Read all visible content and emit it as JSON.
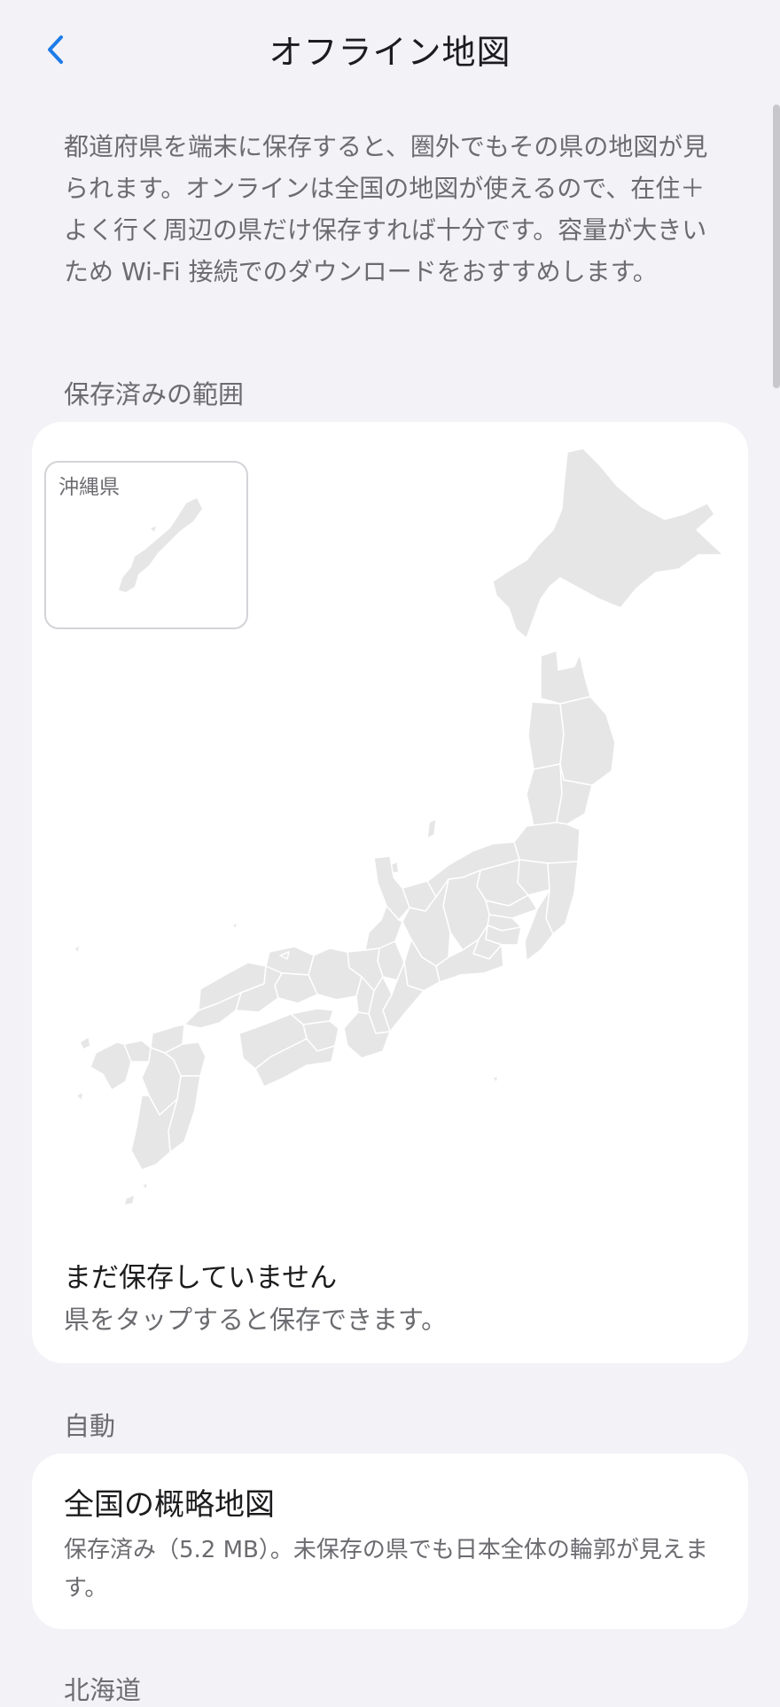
{
  "nav": {
    "title": "オフライン地図",
    "back_icon": "chevron-left-icon",
    "accent_color": "#1e7ce8"
  },
  "intro": "都道府県を端末に保存すると、圏外でもその県の地図が見られます。オンラインは全国の地図が使えるので、在住＋よく行く周辺の県だけ保存すれば十分です。容量が大きいため Wi-Fi 接続でのダウンロードをおすすめします。",
  "saved_section": {
    "label": "保存済みの範囲",
    "inset_label": "沖縄県",
    "map_fill_color": "#e6e6e6",
    "empty_title": "まだ保存していません",
    "empty_subtitle": "県をタップすると保存できます。"
  },
  "auto_section": {
    "label": "自動",
    "item_title": "全国の概略地図",
    "item_description": "保存済み（5.2 MB）。未保存の県でも日本全体の輪郭が見えます。"
  },
  "next_section": {
    "label": "北海道"
  }
}
